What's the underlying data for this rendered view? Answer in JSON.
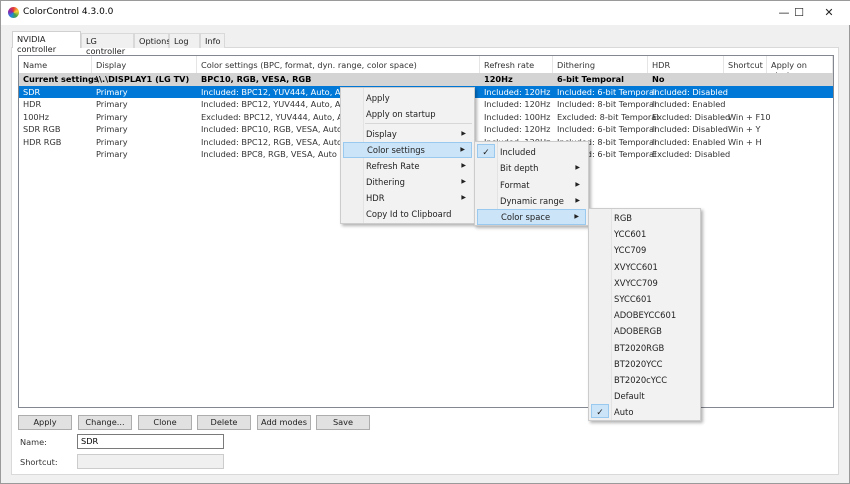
{
  "window": {
    "title": "ColorControl 4.3.0.0",
    "minimize": "—",
    "maximize": "☐",
    "close": "✕"
  },
  "tabs": [
    "NVIDIA controller",
    "LG controller",
    "Options",
    "Log",
    "Info"
  ],
  "columns": [
    "Name",
    "Display",
    "Color settings (BPC, format, dyn. range, color space)",
    "Refresh rate",
    "Dithering",
    "HDR",
    "Shortcut",
    "Apply on startup"
  ],
  "rows": [
    [
      "Current settings",
      "\\\\.\\DISPLAY1 (LG TV)",
      "BPC10, RGB, VESA, RGB",
      "120Hz",
      "6-bit Temporal",
      "No",
      "",
      ""
    ],
    [
      "SDR",
      "Primary",
      "Included: BPC12, YUV444, Auto, Auto",
      "Included: 120Hz",
      "Included: 6-bit Temporal",
      "Included: Disabled",
      "",
      ""
    ],
    [
      "HDR",
      "Primary",
      "Included: BPC12, YUV444, Auto, Auto",
      "Included: 120Hz",
      "Included: 8-bit Temporal",
      "Included: Enabled",
      "",
      ""
    ],
    [
      "100Hz",
      "Primary",
      "Excluded: BPC12, YUV444, Auto, Auto",
      "Included: 100Hz",
      "Excluded: 8-bit Temporal",
      "Excluded: Disabled",
      "Win + F10",
      ""
    ],
    [
      "SDR RGB",
      "Primary",
      "Included: BPC10, RGB, VESA, Auto",
      "Included: 120Hz",
      "Included: 6-bit Temporal",
      "Included: Disabled",
      "Win + Y",
      ""
    ],
    [
      "HDR RGB",
      "Primary",
      "Included: BPC12, RGB, VESA, Auto",
      "Included: 120Hz",
      "Included: 8-bit Temporal",
      "Included: Enabled",
      "Win + H",
      ""
    ],
    [
      "",
      "Primary",
      "Included: BPC8, RGB, VESA, Auto",
      "Included: 120Hz",
      "Included: 6-bit Temporal",
      "Excluded: Disabled",
      "",
      ""
    ]
  ],
  "buttons": [
    "Apply",
    "Change...",
    "Clone",
    "Delete",
    "Add modes",
    "Save"
  ],
  "form": {
    "name_label": "Name:",
    "name_value": "SDR",
    "shortcut_label": "Shortcut:",
    "shortcut_value": ""
  },
  "context_menu": [
    "Apply",
    "Apply on startup",
    "Display",
    "Color settings",
    "Refresh Rate",
    "Dithering",
    "HDR",
    "Copy Id to Clipboard"
  ],
  "color_settings_menu": [
    "Included",
    "Bit depth",
    "Format",
    "Dynamic range",
    "Color space"
  ],
  "color_space_menu": [
    "RGB",
    "YCC601",
    "YCC709",
    "XVYCC601",
    "XVYCC709",
    "SYCC601",
    "ADOBEYCC601",
    "ADOBERGB",
    "BT2020RGB",
    "BT2020YCC",
    "BT2020cYCC",
    "Default",
    "Auto"
  ],
  "colors": {
    "selection": "#0078d7",
    "menu_highlight": "#cce4f7"
  }
}
